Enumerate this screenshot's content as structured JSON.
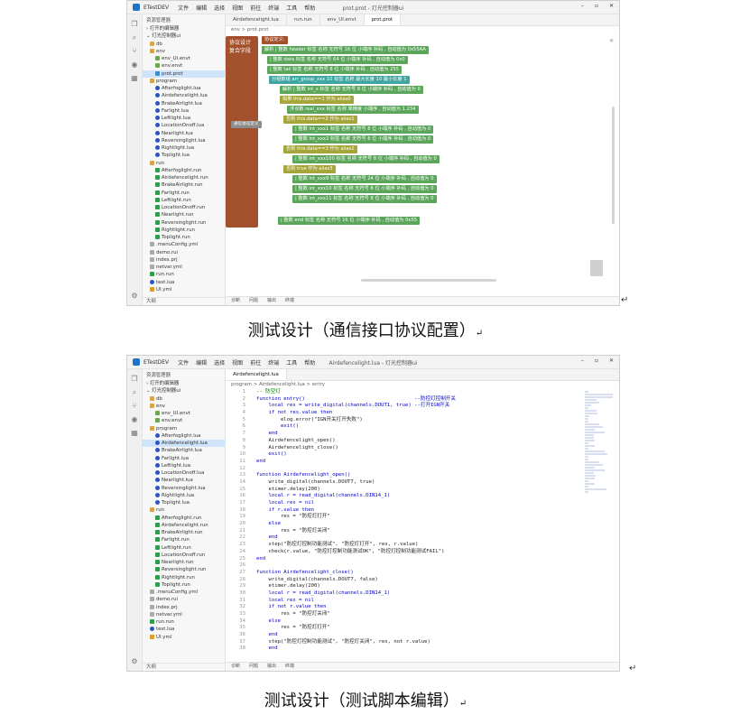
{
  "figure1": {
    "app": {
      "name": "ETestDEV",
      "menu": [
        "文件",
        "编辑",
        "选择",
        "视图",
        "前往",
        "终端",
        "工具",
        "帮助"
      ],
      "window_title": "prot.prot - 灯光控制器ui"
    },
    "sidebar": {
      "header": "资源管理器",
      "open_editors": "打开的编辑器",
      "project": "灯光控制器ui",
      "tree": [
        {
          "label": "db",
          "kind": "folder",
          "indent": 1
        },
        {
          "label": "env",
          "kind": "folder",
          "indent": 1
        },
        {
          "label": "env_UI.envt",
          "kind": "env",
          "indent": 2
        },
        {
          "label": "env.envt",
          "kind": "env",
          "indent": 2
        },
        {
          "label": "prot.prot",
          "kind": "prot",
          "indent": 2,
          "selected": true
        },
        {
          "label": "program",
          "kind": "folder",
          "indent": 1
        },
        {
          "label": "Afterfoglight.lua",
          "kind": "lua",
          "indent": 2
        },
        {
          "label": "Airdefencelight.lua",
          "kind": "lua",
          "indent": 2
        },
        {
          "label": "BrakeAirlight.lua",
          "kind": "lua",
          "indent": 2
        },
        {
          "label": "Farlight.lua",
          "kind": "lua",
          "indent": 2
        },
        {
          "label": "Leftlight.lua",
          "kind": "lua",
          "indent": 2
        },
        {
          "label": "LocationOnoff.lua",
          "kind": "lua",
          "indent": 2
        },
        {
          "label": "Nearlight.lua",
          "kind": "lua",
          "indent": 2
        },
        {
          "label": "Reversinglight.lua",
          "kind": "lua",
          "indent": 2
        },
        {
          "label": "Rightlight.lua",
          "kind": "lua",
          "indent": 2
        },
        {
          "label": "Toplight.lua",
          "kind": "lua",
          "indent": 2
        },
        {
          "label": "run",
          "kind": "folder",
          "indent": 1
        },
        {
          "label": "Afterfoglight.run",
          "kind": "run",
          "indent": 2
        },
        {
          "label": "Airdefencelight.run",
          "kind": "run",
          "indent": 2
        },
        {
          "label": "BrakeAirlight.run",
          "kind": "run",
          "indent": 2
        },
        {
          "label": "Farlight.run",
          "kind": "run",
          "indent": 2
        },
        {
          "label": "Leftlight.run",
          "kind": "run",
          "indent": 2
        },
        {
          "label": "LocationOnoff.run",
          "kind": "run",
          "indent": 2
        },
        {
          "label": "Nearlight.run",
          "kind": "run",
          "indent": 2
        },
        {
          "label": "Reversinglight.run",
          "kind": "run",
          "indent": 2
        },
        {
          "label": "Rightlight.run",
          "kind": "run",
          "indent": 2
        },
        {
          "label": "Toplight.run",
          "kind": "run",
          "indent": 2
        },
        {
          "label": ".menuConfig.yml",
          "kind": "file",
          "indent": 1
        },
        {
          "label": "demo.rui",
          "kind": "file",
          "indent": 1
        },
        {
          "label": "index.prj",
          "kind": "file",
          "indent": 1
        },
        {
          "label": "netvar.yml",
          "kind": "file",
          "indent": 1
        },
        {
          "label": "run.run",
          "kind": "run",
          "indent": 1
        },
        {
          "label": "test.lua",
          "kind": "lua",
          "indent": 1
        },
        {
          "label": "UI.yml",
          "kind": "ui",
          "indent": 1
        }
      ],
      "outline": "大纲"
    },
    "tabs": [
      "Airdefencelight.lua",
      "run.run",
      "env_UI.envt",
      "prot.prot"
    ],
    "breadcrumb": "env > prot.prot",
    "blocks": {
      "proto_title": "协议设计",
      "proto_sub": "复合字段",
      "tooltip": "通信协议定义",
      "rows": [
        {
          "text": "协议定义:",
          "chips": [
            "名称",
            "从 组比特位 ",
            "开始"
          ],
          "color": "red"
        },
        {
          "text": "解析 | 整数 header 标签 名称 无符号 16 位 小端序 补码 , 自动值为 0x55AA",
          "chips": [],
          "color": "green"
        },
        {
          "text": "| 整数 data 标签 名称 无符号 64 位 小端序 补码 , 自动值为 0x0",
          "chips": [],
          "color": "green"
        },
        {
          "text": "| 整数 tail 标签 名称 无符号 8 位 小端序 补码 , 自动值为 255",
          "chips": [],
          "color": "green"
        },
        {
          "text": "分组数组 arr_group_xxx 10 标签 名称 最大长度 10 最小长度 1",
          "chips": [],
          "color": "teal"
        },
        {
          "text": "解析 | 整数 int_x 标签 名称 无符号 8 位 小端序 补码 , 自动值为 0",
          "chips": [],
          "color": "green"
        },
        {
          "text": "如果 this.data==1 作为 alias0",
          "chips": [],
          "color": "olive"
        },
        {
          "text": "浮点数 real_xxx 标签 名称 单精度 小端序 , 自动值为 1.234",
          "chips": [],
          "color": "green"
        },
        {
          "text": "否则 this.data==2 作为 alias1",
          "chips": [],
          "color": "olive"
        },
        {
          "text": "| 整数 int_xxx1 标签 名称 无符号 8 位 小端序 补码 , 自动值为 0",
          "chips": [],
          "color": "green"
        },
        {
          "text": "| 整数 int_xxx2 标签 名称 无符号 8 位 小端序 补码 , 自动值为 0",
          "chips": [],
          "color": "green"
        },
        {
          "text": "否则 this.data==3 作为 alias2",
          "chips": [],
          "color": "olive"
        },
        {
          "text": "| 整数 int_xxx100 标签 名称 无符号 8 位 小端序 补码 , 自动值为 0",
          "chips": [],
          "color": "green"
        },
        {
          "text": "否则 true 作为 alias3",
          "chips": [],
          "color": "olive"
        },
        {
          "text": "| 整数 int_xxx9 标签 名称 无符号 24 位 小端序 补码 , 自动值为 0",
          "chips": [],
          "color": "green"
        },
        {
          "text": "| 整数 int_xxx10 标签 名称 无符号 8 位 小端序 补码 , 自动值为 0",
          "chips": [],
          "color": "green"
        },
        {
          "text": "| 整数 int_xxx11 标签 名称 无符号 8 位 小端序 补码 , 自动值为 0",
          "chips": [],
          "color": "green"
        },
        {
          "text": "| 整数 end 标签 名称 无符号 16 位 小端序 补码 , 自动值为 0x55",
          "chips": [],
          "color": "green"
        }
      ]
    },
    "status": [
      "诊断",
      "问题",
      "输出",
      "终端"
    ],
    "caption": "测试设计（通信接口协议配置）"
  },
  "figure2": {
    "app": {
      "name": "ETestDEV",
      "menu": [
        "文件",
        "编辑",
        "选择",
        "视图",
        "前往",
        "终端",
        "工具",
        "帮助"
      ],
      "window_title": "Airdefencelight.lua - 灯光控制器ui"
    },
    "sidebar": {
      "header": "资源管理器",
      "open_editors": "打开的编辑器",
      "project": "灯光控制器ui",
      "tree": [
        {
          "label": "db",
          "kind": "folder",
          "indent": 1
        },
        {
          "label": "env",
          "kind": "folder",
          "indent": 1
        },
        {
          "label": "env_UI.envt",
          "kind": "env",
          "indent": 2
        },
        {
          "label": "env.envt",
          "kind": "env",
          "indent": 2
        },
        {
          "label": "program",
          "kind": "folder",
          "indent": 1
        },
        {
          "label": "Afterfoglight.lua",
          "kind": "lua",
          "indent": 2
        },
        {
          "label": "Airdefencelight.lua",
          "kind": "lua",
          "indent": 2,
          "selected": true
        },
        {
          "label": "BrakeAirlight.lua",
          "kind": "lua",
          "indent": 2
        },
        {
          "label": "Farlight.lua",
          "kind": "lua",
          "indent": 2
        },
        {
          "label": "Leftlight.lua",
          "kind": "lua",
          "indent": 2
        },
        {
          "label": "LocationOnoff.lua",
          "kind": "lua",
          "indent": 2
        },
        {
          "label": "Nearlight.lua",
          "kind": "lua",
          "indent": 2
        },
        {
          "label": "Reversinglight.lua",
          "kind": "lua",
          "indent": 2
        },
        {
          "label": "Rightlight.lua",
          "kind": "lua",
          "indent": 2
        },
        {
          "label": "Toplight.lua",
          "kind": "lua",
          "indent": 2
        },
        {
          "label": "run",
          "kind": "folder",
          "indent": 1
        },
        {
          "label": "Afterfoglight.run",
          "kind": "run",
          "indent": 2
        },
        {
          "label": "Airdefencelight.run",
          "kind": "run",
          "indent": 2
        },
        {
          "label": "BrakeAirlight.run",
          "kind": "run",
          "indent": 2
        },
        {
          "label": "Farlight.run",
          "kind": "run",
          "indent": 2
        },
        {
          "label": "Leftlight.run",
          "kind": "run",
          "indent": 2
        },
        {
          "label": "LocationOnoff.run",
          "kind": "run",
          "indent": 2
        },
        {
          "label": "Nearlight.run",
          "kind": "run",
          "indent": 2
        },
        {
          "label": "Reversinglight.run",
          "kind": "run",
          "indent": 2
        },
        {
          "label": "Rightlight.run",
          "kind": "run",
          "indent": 2
        },
        {
          "label": "Toplight.run",
          "kind": "run",
          "indent": 2
        },
        {
          "label": ".menuConfig.yml",
          "kind": "file",
          "indent": 1
        },
        {
          "label": "demo.rui",
          "kind": "file",
          "indent": 1
        },
        {
          "label": "index.prj",
          "kind": "file",
          "indent": 1
        },
        {
          "label": "netvar.yml",
          "kind": "file",
          "indent": 1
        },
        {
          "label": "run.run",
          "kind": "run",
          "indent": 1
        },
        {
          "label": "test.lua",
          "kind": "lua",
          "indent": 1
        },
        {
          "label": "UI.yml",
          "kind": "ui",
          "indent": 1
        }
      ],
      "outline": "大纲"
    },
    "tabs": [
      "Airdefencelight.lua"
    ],
    "breadcrumb": "program > Airdefencelight.lua > entry",
    "code_lines": [
      "-- 防空灯",
      "function entry()                                    --防控灯控制开关",
      "    local res = write_digital(channels.DOUT1, true) --打开IGN开关",
      "    if not res.value then",
      "        elog.error(\"IGN开关打开失败\")",
      "        exit()",
      "    end",
      "    Airdefencelight_open()",
      "    Airdefencelight_close()",
      "    exit()",
      "end",
      "",
      "function Airdefencelight_open()",
      "    write_digital(channels.DOUT7, true)",
      "    etimer.delay(200)",
      "    local r = read_digital(channels.DIN14_1)",
      "    local res = nil",
      "    if r.value then",
      "        res = \"防控灯打开\"",
      "    else",
      "        res = \"防控灯关闭\"",
      "    end",
      "    step(\"防控灯控制功能测试\", \"防控灯打开\", res, r.value)",
      "    check(r.value, \"防控灯控制功能测试OK\", \"防控灯控制功能测试FAIL\")",
      "end",
      "",
      "function Airdefencelight_close()",
      "    write_digital(channels.DOUT7, false)",
      "    etimer.delay(200)",
      "    local r = read_digital(channels.DIN14_1)",
      "    local res = nil",
      "    if not r.value then",
      "        res = \"防控灯关闭\"",
      "    else",
      "        res = \"防控灯打开\"",
      "    end",
      "    step(\"防控灯控制功能测试\", \"防控灯关闭\", res, not r.value)",
      "    end"
    ],
    "status": [
      "诊断",
      "问题",
      "输出",
      "终端"
    ],
    "caption": "测试设计（测试脚本编辑）"
  },
  "colors": {
    "protocol_block": "#a3502c",
    "field_block": "#5ca65c",
    "condition_block": "#a5a53a",
    "array_block": "#3fa6a1",
    "selection": "#cfe3fb"
  }
}
